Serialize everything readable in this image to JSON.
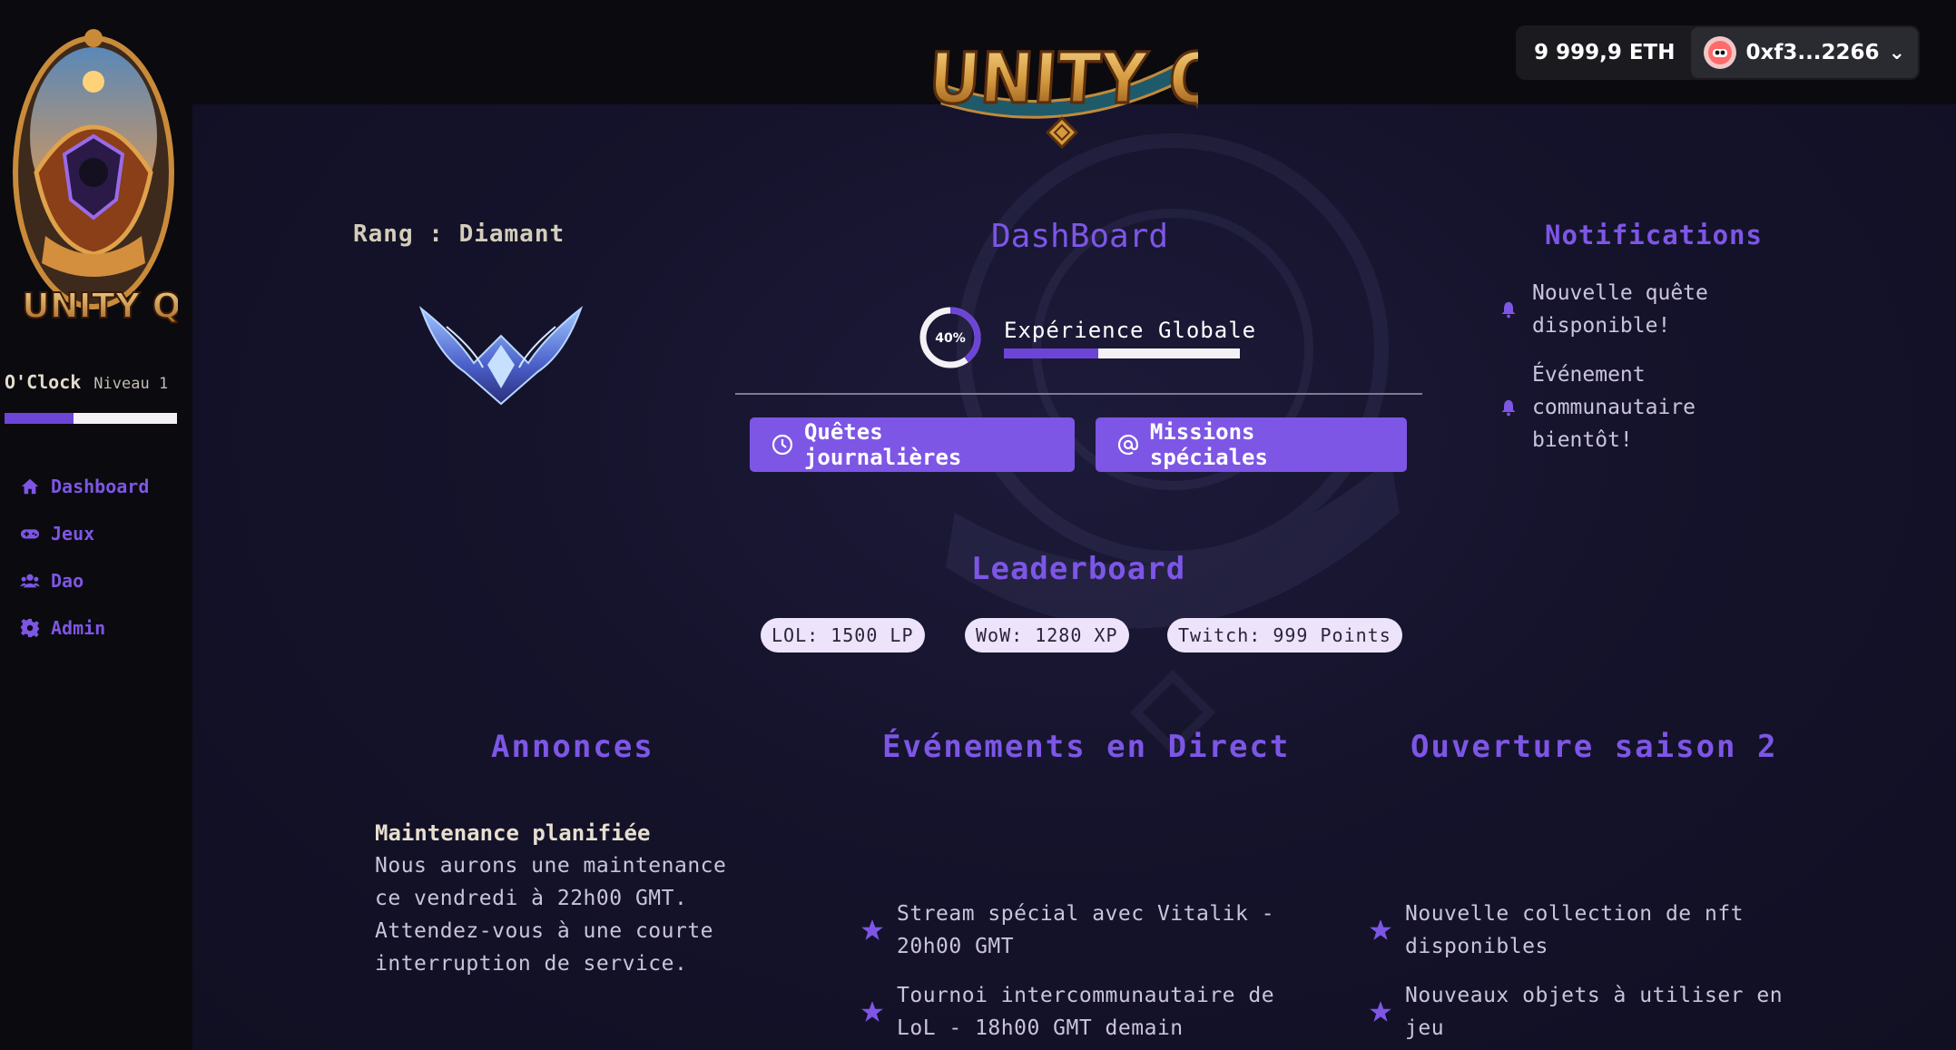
{
  "header": {
    "logo_text": "UNITY QUEST",
    "balance": "9 999,9 ETH",
    "address": "0xf3...2266",
    "chevron": "⌄"
  },
  "sidebar": {
    "logo_text": "UNITY QUEST",
    "user_name": "O'Clock",
    "level": "Niveau 1",
    "level_progress": 0.4,
    "items": [
      {
        "label": "Dashboard",
        "icon": "home-icon"
      },
      {
        "label": "Jeux",
        "icon": "gamepad-icon"
      },
      {
        "label": "Dao",
        "icon": "users-icon"
      },
      {
        "label": "Admin",
        "icon": "gear-icon"
      }
    ]
  },
  "rank": {
    "label": "Rang : Diamant",
    "icon": "diamond-rank-emblem"
  },
  "dashboard": {
    "title": "DashBoard",
    "xp_percent": "40%",
    "xp_progress": 0.4,
    "xp_label": "Expérience Globale",
    "btn_daily": "Quêtes journalières",
    "btn_special": "Missions spéciales"
  },
  "notifications": {
    "title": "Notifications",
    "items": [
      "Nouvelle quête disponible!",
      "Événement communautaire bientôt!"
    ]
  },
  "leaderboard": {
    "title": "Leaderboard",
    "chips": [
      "LOL: 1500 LP",
      "WoW: 1280 XP",
      "Twitch: 999 Points"
    ]
  },
  "announcements": {
    "title": "Annonces",
    "heading": "Maintenance planifiée",
    "body": "Nous aurons une maintenance ce vendredi à 22h00 GMT. Attendez-vous à une courte interruption de service."
  },
  "events": {
    "title": "Événements en Direct",
    "items": [
      "Stream spécial avec Vitalik - 20h00 GMT",
      "Tournoi intercommunautaire de LoL - 18h00 GMT demain"
    ]
  },
  "season": {
    "title": "Ouverture saison 2",
    "items": [
      "Nouvelle collection de nft disponibles",
      "Nouveaux objets à utiliser en jeu"
    ]
  },
  "colors": {
    "accent": "#7d56e6",
    "background": "#15132b",
    "sidebar": "#0b0a0e"
  }
}
